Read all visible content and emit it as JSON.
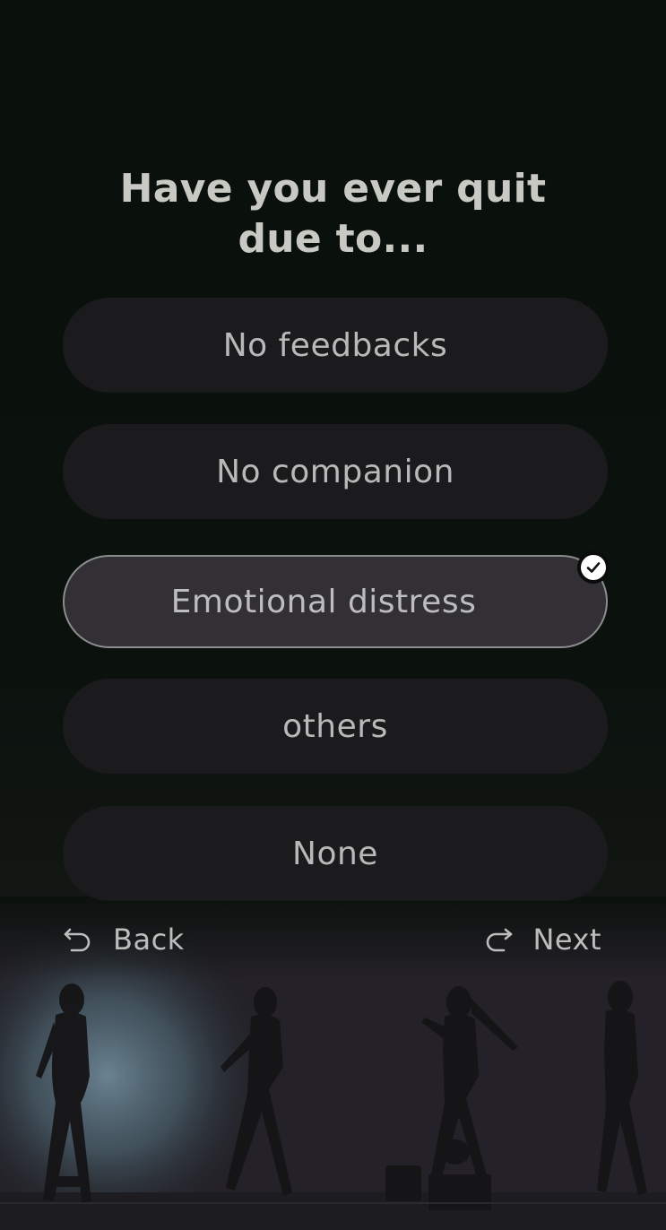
{
  "question": {
    "line1": "Have you ever quit",
    "line2": "due to..."
  },
  "options": [
    {
      "label": "No feedbacks",
      "selected": false
    },
    {
      "label": "No companion",
      "selected": false
    },
    {
      "label": "Emotional distress",
      "selected": true
    },
    {
      "label": "others",
      "selected": false
    },
    {
      "label": "None",
      "selected": false
    }
  ],
  "nav": {
    "back_label": "Back",
    "next_label": "Next",
    "back_icon": "undo-arrow-icon",
    "next_icon": "redo-arrow-icon"
  },
  "background": {
    "description_icon": "concert-silhouette-illustration",
    "spotlight_color": "#6e8796",
    "base_color": "#0b110d"
  },
  "colors": {
    "option_bg": "#1b1b1d",
    "option_selected_bg": "#323034",
    "option_selected_border": "#8c8c8e",
    "text": "#b9b9b9",
    "title": "#c9c9c4"
  }
}
